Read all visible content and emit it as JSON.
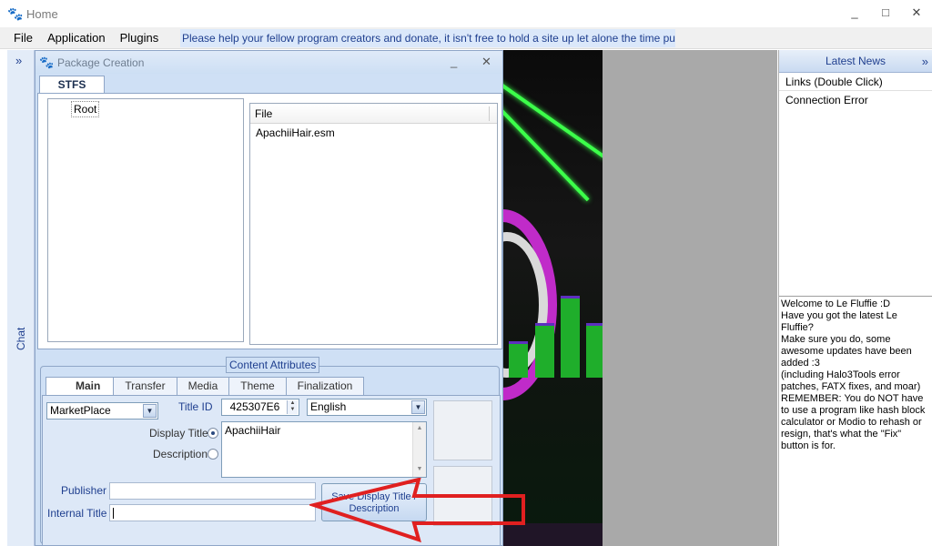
{
  "window": {
    "title": "Home",
    "icon": "paw-icon",
    "controls": [
      "_",
      "□",
      "✕"
    ]
  },
  "menu": {
    "items": [
      "File",
      "Application",
      "Plugins"
    ],
    "donate_text": "Please help your fellow program creators and donate, it isn't free to hold a site up let alone the time put into this"
  },
  "chat": {
    "label": "Chat",
    "toggle": "»"
  },
  "news": {
    "title": "Latest News",
    "toggle": "»",
    "items": [
      "Links (Double Click)",
      "Connection Error"
    ],
    "welcome": "Welcome to Le Fluffie :D\nHave you got the latest Le Fluffie?\nMake sure you do, some awesome updates have been added :3\n(including Halo3Tools error patches, FATX fixes, and moar)\nREMEMBER: You do NOT have to use a program like hash block calculator or Modio to rehash or resign, that's what the \"Fix\" button is for."
  },
  "dialog": {
    "title": "Package Creation",
    "controls": [
      "_",
      "✕"
    ],
    "tab": "STFS",
    "tree_root": "Root",
    "file_header": "File",
    "files": [
      "ApachiiHair.esm"
    ],
    "content_attributes": {
      "label": "Content Attributes",
      "tabs": [
        "Main",
        "Transfer",
        "Media",
        "Theme",
        "Finalization"
      ],
      "active_tab": "Main",
      "content_type": "MarketPlace",
      "title_id_label": "Title ID",
      "title_id": "425307E6",
      "language": "English",
      "display_title_label": "Display Title",
      "description_label": "Description",
      "display_title_value": "ApachiiHair",
      "publisher_label": "Publisher",
      "publisher_value": "",
      "internal_title_label": "Internal Title",
      "internal_title_value": "",
      "save_button": "Save Display Title / Description"
    }
  },
  "colors": {
    "accent_blue": "#1f3f8f",
    "dialog_bg": "#cfe0f5",
    "laser_green": "#3cff4a",
    "arrow_red": "#e02020"
  }
}
